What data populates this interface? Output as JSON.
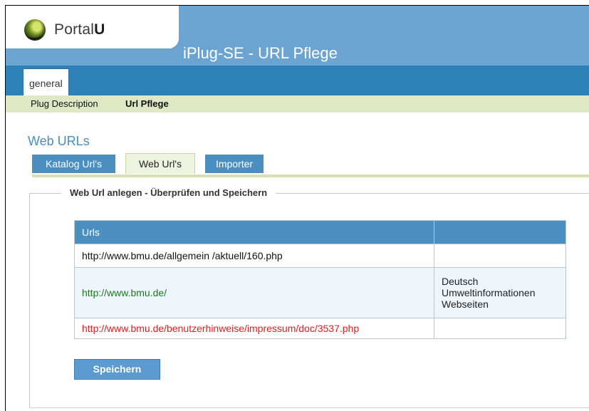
{
  "header": {
    "logo_text_a": "Portal",
    "logo_text_b": "U",
    "app_title": "iPlug-SE - URL Pflege"
  },
  "nav": {
    "tab_label": "general",
    "sub_items": [
      "Plug Description",
      "Url Pflege"
    ]
  },
  "page": {
    "title": "Web URLs",
    "tabs": [
      "Katalog Url's",
      "Web Url's",
      "Importer"
    ],
    "active_tab": "Web Url's"
  },
  "section": {
    "legend": "Web Url anlegen - Überprüfen und Speichern"
  },
  "table": {
    "headers": [
      "Urls",
      ""
    ],
    "rows": [
      {
        "url": "http://www.bmu.de/allgemein /aktuell/160.php",
        "desc": ""
      },
      {
        "url": "http://www.bmu.de/",
        "desc": "Deutsch Umweltinformationen Webseiten"
      },
      {
        "url": "http://www.bmu.de/benutzerhinweise/impressum/doc/3537.php",
        "desc": ""
      }
    ]
  },
  "buttons": {
    "save": "Speichern"
  },
  "colors": {
    "header_blue": "#6ba3d1",
    "nav_blue": "#2d80b8",
    "ok_url": "#1f7a1f",
    "error_url": "#d82020"
  }
}
